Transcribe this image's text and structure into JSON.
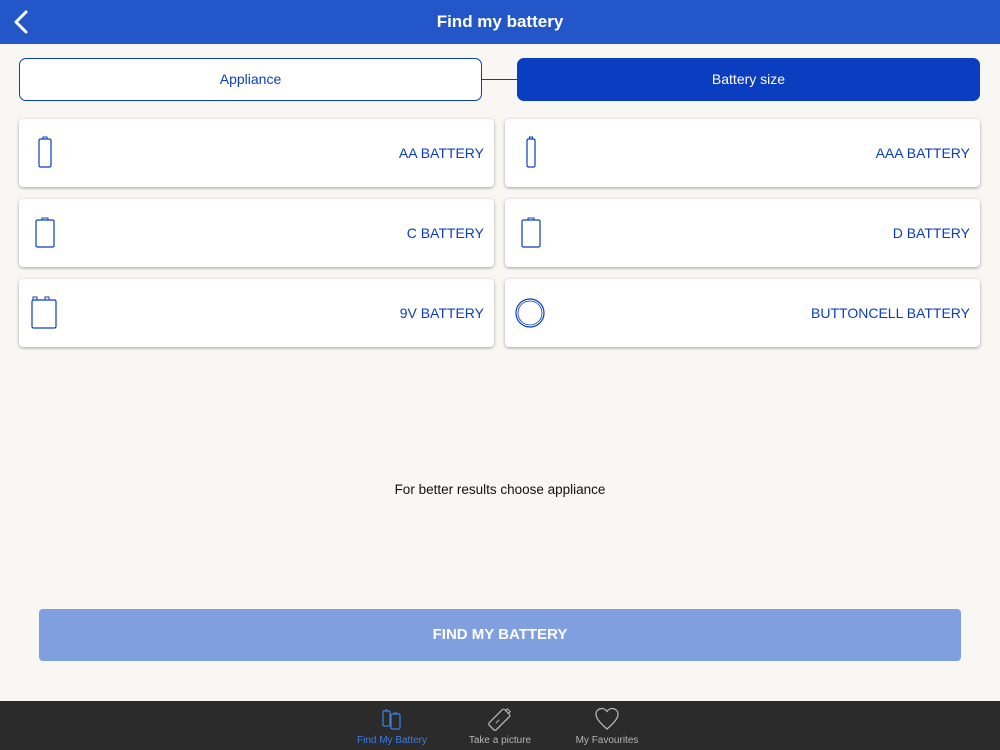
{
  "header": {
    "title": "Find my battery"
  },
  "segments": {
    "appliance": "Appliance",
    "battery_size": "Battery size",
    "active": "battery_size"
  },
  "batteries": [
    {
      "label": "AA BATTERY",
      "icon": "aa-battery-icon"
    },
    {
      "label": "AAA BATTERY",
      "icon": "aaa-battery-icon"
    },
    {
      "label": "C BATTERY",
      "icon": "c-battery-icon"
    },
    {
      "label": "D BATTERY",
      "icon": "d-battery-icon"
    },
    {
      "label": "9V BATTERY",
      "icon": "9v-battery-icon"
    },
    {
      "label": "BUTTONCELL BATTERY",
      "icon": "buttoncell-battery-icon"
    }
  ],
  "hint": "For better results choose appliance",
  "find_button": "FIND MY BATTERY",
  "tabs": [
    {
      "label": "Find My Battery",
      "icon": "battery-tab-icon",
      "active": true
    },
    {
      "label": "Take a picture",
      "icon": "camera-battery-icon",
      "active": false
    },
    {
      "label": "My Favourites",
      "icon": "heart-icon",
      "active": false
    }
  ],
  "colors": {
    "header": "#2356c8",
    "accent": "#0a3dbf",
    "button": "#7f9fdf",
    "tabbar": "#2b2b2b",
    "tab_active": "#3e7bdf"
  }
}
